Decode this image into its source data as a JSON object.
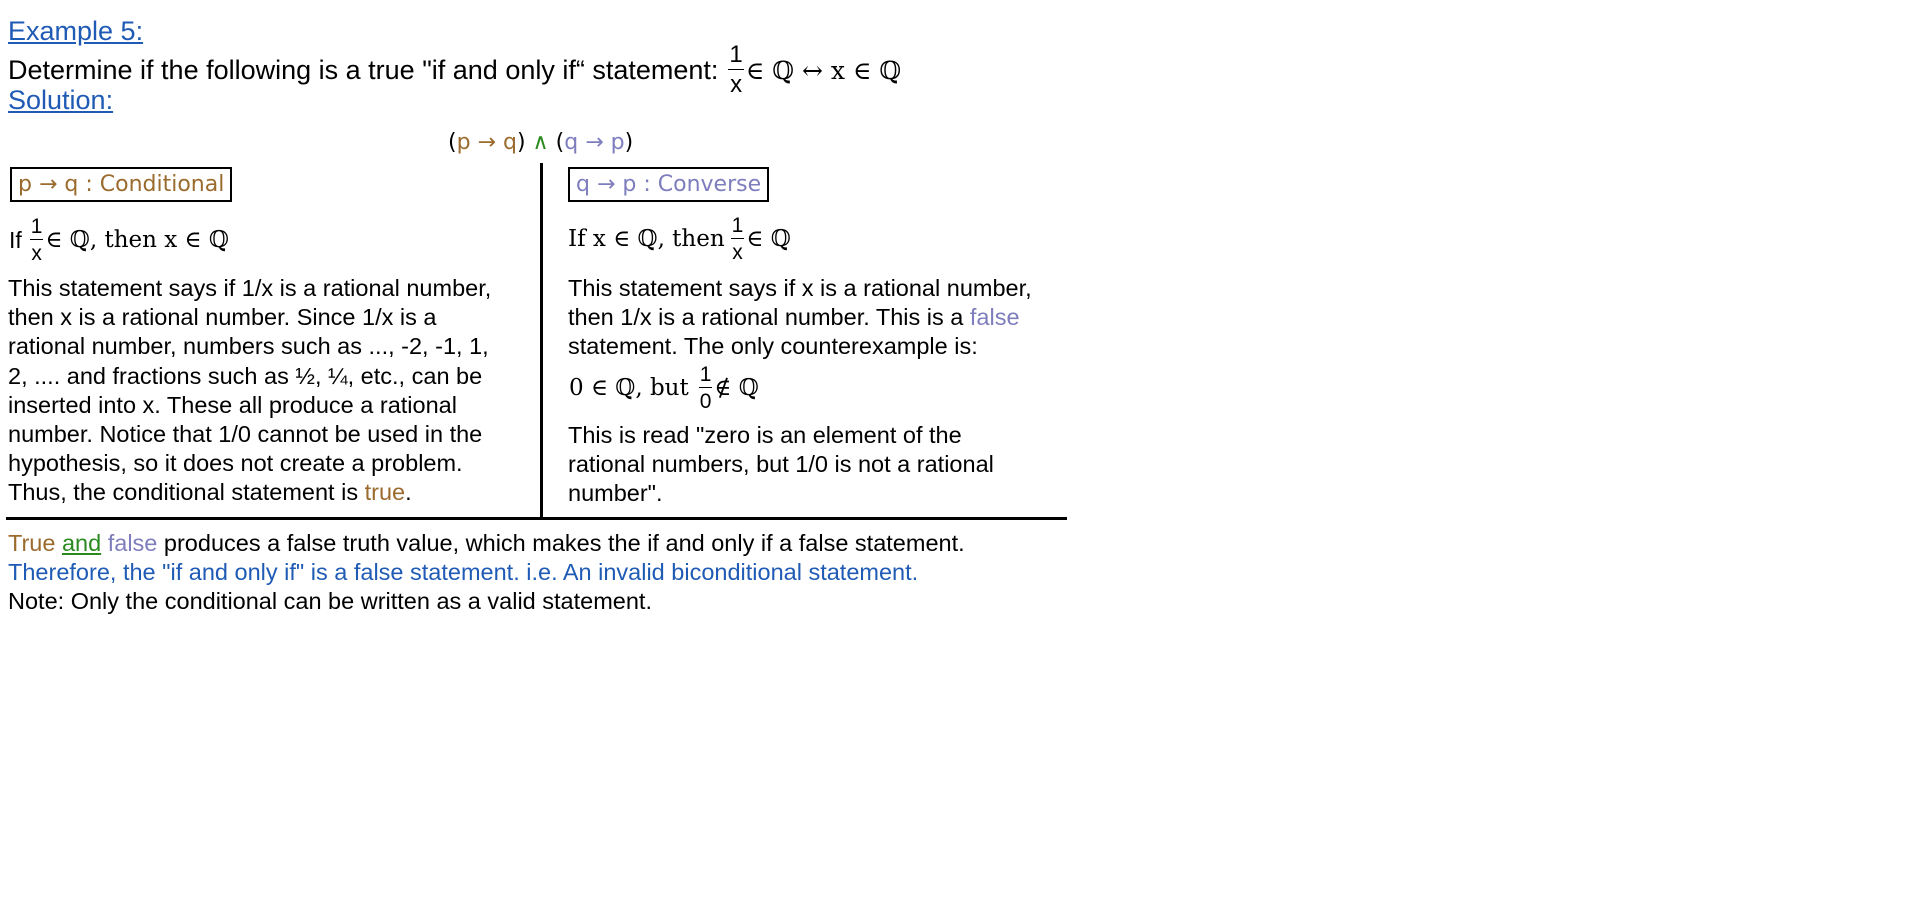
{
  "header": {
    "example_title": "Example 5:",
    "prompt_text": "Determine if the following is a true \"if and only if“ statement:",
    "statement_num": "1",
    "statement_den": "x",
    "statement_rest": "∈ ℚ ↔ x ∈ ℚ",
    "solution_label": "Solution:"
  },
  "formula": {
    "open1": "(",
    "p1": "p → q",
    "close1": ")",
    "and": "∧",
    "open2": "(",
    "q2": "q → p",
    "close2": ")"
  },
  "left": {
    "box_label": "p → q : Conditional",
    "if_word": "If",
    "frac_num": "1",
    "frac_den": "x",
    "if_rest": "∈ ℚ, then x ∈ ℚ",
    "lines": [
      "This statement says if 1/x is a rational number,",
      "then x is a rational number.  Since 1/x is a",
      "rational number, numbers such as ..., -2, -1, 1,",
      "2, .... and fractions such as ½, ¼, etc., can be",
      "inserted into x.  These all produce a rational",
      "number.  Notice that 1/0 cannot be used in the",
      "hypothesis, so it does not create a problem."
    ],
    "last_line_prefix": "Thus, the conditional statement is ",
    "last_line_colored": "true",
    "last_line_suffix": "."
  },
  "right": {
    "box_label": "q → p :  Converse",
    "if_prefix": "If  x ∈ ℚ, then",
    "frac_num": "1",
    "frac_den": "x",
    "if_rest": "∈ ℚ",
    "line1": "This statement says if x is a rational number,",
    "line2_prefix": "then 1/x is a rational number.  This is a ",
    "line2_colored": "false",
    "line3": "statement.  The only counterexample is:",
    "counter_prefix": "0 ∈ ℚ,  but",
    "counter_num": "1",
    "counter_den": "0",
    "counter_rest": "∉ ℚ",
    "read_lines": [
      "This is read \"zero is an element of the",
      "rational numbers, but 1/0 is not a rational",
      "number\"."
    ]
  },
  "conclusion": {
    "true_word": "True",
    "and_word": "and",
    "false_word": "false",
    "rest_text": " produces a false truth value, which makes the if and only if a false statement.",
    "therefore_text": "Therefore, the \"if and only if\" is a false statement.  i.e. An invalid biconditional statement.",
    "note_text": "Note:  Only the conditional can be written as a valid statement."
  }
}
